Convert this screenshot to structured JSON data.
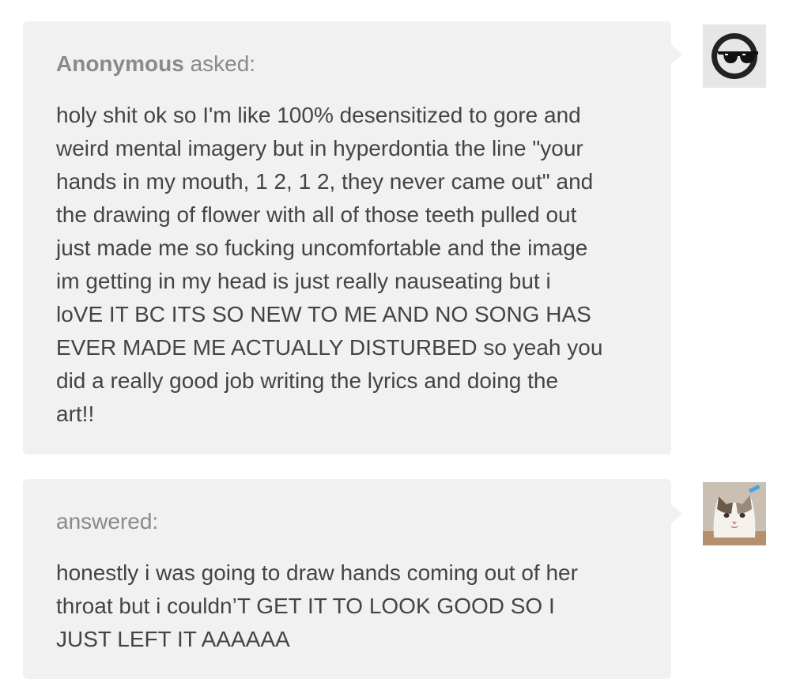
{
  "ask": {
    "asker_name": "Anonymous",
    "asked_label": "asked:",
    "avatar_icon": "sunglasses-face-icon",
    "lines": [
      "holy shit ok so I'm like 100% desensitized to gore and",
      "weird mental imagery but in hyperdontia the line \"your",
      "hands in my mouth, 1 2, 1 2, they never came out\" and",
      "the drawing of flower with all of those teeth pulled out",
      "just made me so fucking uncomfortable and the image",
      "im getting in my head is just really nauseating but i",
      "loVE IT BC ITS SO NEW TO ME AND NO SONG HAS",
      "EVER MADE ME ACTUALLY DISTURBED so yeah you",
      "did a really good job writing the lyrics and doing the",
      "art!!"
    ]
  },
  "answer": {
    "answered_label": "answered:",
    "avatar_icon": "cat-photo-icon",
    "lines": [
      "honestly i was going to draw hands coming out of her",
      "throat but i couldn’T GET IT TO LOOK GOOD SO I",
      "JUST LEFT IT AAAAAA"
    ]
  },
  "colors": {
    "bubble_bg": "#f1f1f1",
    "heading_text": "#8a8a8a",
    "body_text": "#444444"
  }
}
